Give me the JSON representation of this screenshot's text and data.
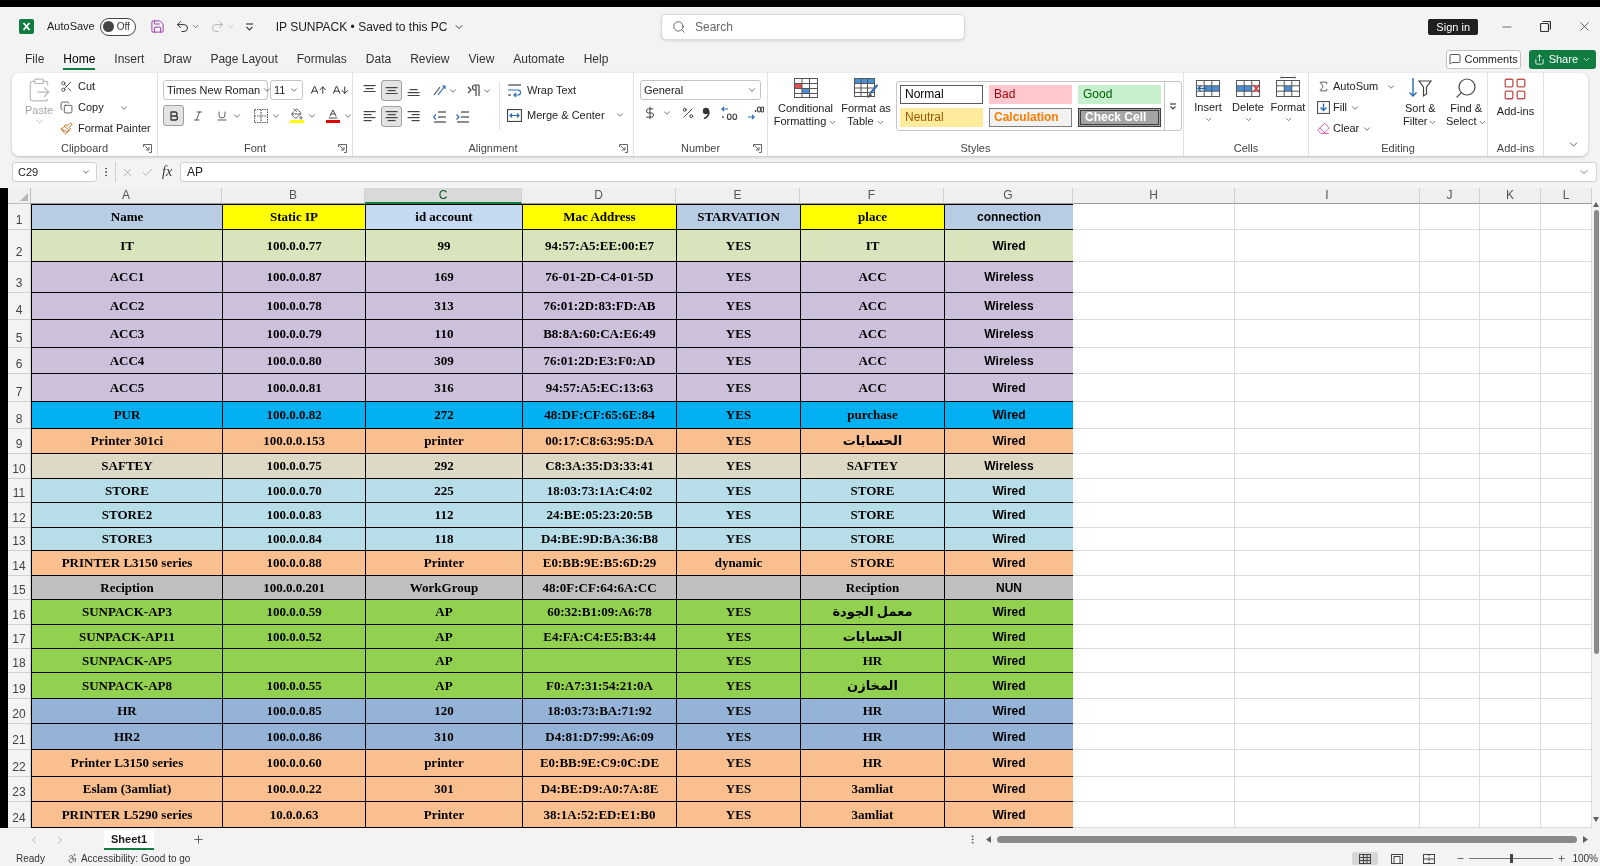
{
  "title_bar": {
    "autosave_label": "AutoSave",
    "autosave": {
      "label": "Off",
      "on": false
    },
    "quick_access": [
      {
        "kind": "save",
        "disabled": false
      },
      {
        "kind": "undo",
        "disabled": false
      },
      {
        "kind": "redo",
        "disabled": true
      }
    ],
    "document_title": "IP SUNPACK • Saved to this PC",
    "search": {
      "placeholder": "Search"
    },
    "sign_in": "Sign in"
  },
  "menu_tabs": [
    {
      "label": "File",
      "selected": false
    },
    {
      "label": "Home",
      "selected": true
    },
    {
      "label": "Insert",
      "selected": false
    },
    {
      "label": "Draw",
      "selected": false
    },
    {
      "label": "Page Layout",
      "selected": false
    },
    {
      "label": "Formulas",
      "selected": false
    },
    {
      "label": "Data",
      "selected": false
    },
    {
      "label": "Review",
      "selected": false
    },
    {
      "label": "View",
      "selected": false
    },
    {
      "label": "Automate",
      "selected": false
    },
    {
      "label": "Help",
      "selected": false
    }
  ],
  "header_actions": {
    "comments": "Comments",
    "share": "Share"
  },
  "ribbon": {
    "clipboard": {
      "title": "Clipboard",
      "paste": {
        "label": "Paste",
        "disabled": true
      },
      "cut": "Cut",
      "copy": "Copy",
      "format_painter": "Format Painter"
    },
    "font": {
      "title": "Font",
      "name": "Times New Roman",
      "size": "11",
      "formats": [
        {
          "kind": "bold",
          "active": true
        },
        {
          "kind": "italic",
          "active": false
        },
        {
          "kind": "underline",
          "active": false
        }
      ]
    },
    "alignment": {
      "title": "Alignment",
      "vertical": [
        {
          "kind": "top",
          "active": false
        },
        {
          "kind": "middle",
          "active": true
        },
        {
          "kind": "bottom",
          "active": false
        }
      ],
      "horizontal": [
        {
          "kind": "left",
          "active": false
        },
        {
          "kind": "center",
          "active": true
        },
        {
          "kind": "right",
          "active": false
        }
      ],
      "wrap_text": "Wrap Text",
      "merge_center": "Merge & Center"
    },
    "number": {
      "title": "Number",
      "format": "General"
    },
    "styles": {
      "title": "Styles",
      "conditional_formatting": "Conditional Formatting",
      "format_as_table": "Format as Table",
      "cell_styles": [
        {
          "label": "Normal",
          "kind": "normal"
        },
        {
          "label": "Bad",
          "kind": "bad"
        },
        {
          "label": "Good",
          "kind": "good"
        },
        {
          "label": "Neutral",
          "kind": "neutral"
        },
        {
          "label": "Calculation",
          "kind": "calculation"
        },
        {
          "label": "Check Cell",
          "kind": "check"
        }
      ]
    },
    "cells": {
      "title": "Cells",
      "buttons": [
        {
          "kind": "insert",
          "label": "Insert"
        },
        {
          "kind": "delete",
          "label": "Delete"
        },
        {
          "kind": "format",
          "label": "Format"
        }
      ]
    },
    "editing": {
      "title": "Editing",
      "autosum": "AutoSum",
      "fill": "Fill",
      "clear": "Clear",
      "sort_filter": "Sort & Filter",
      "find_select": "Find & Select"
    },
    "add_ins": {
      "title": "Add-ins",
      "button": "Add-ins"
    }
  },
  "formula_bar": {
    "name_box": "C29",
    "function_button": "fx",
    "formula": "AP"
  },
  "sheet": {
    "columns": [
      {
        "label": "A",
        "selected": false
      },
      {
        "label": "B",
        "selected": false
      },
      {
        "label": "C",
        "selected": true
      },
      {
        "label": "D",
        "selected": false
      },
      {
        "label": "E",
        "selected": false
      },
      {
        "label": "F",
        "selected": false
      },
      {
        "label": "G",
        "selected": false
      },
      {
        "label": "H",
        "selected": false
      },
      {
        "label": "I",
        "selected": false
      },
      {
        "label": "J",
        "selected": false
      },
      {
        "label": "K",
        "selected": false
      },
      {
        "label": "L",
        "selected": false
      }
    ],
    "header_row": {
      "number": "1",
      "cells": [
        {
          "text": "Name",
          "color": "#b8cce4"
        },
        {
          "text": "Static IP",
          "color": "#ffff00"
        },
        {
          "text": "id account",
          "color": "#c5d9f1"
        },
        {
          "text": "Mac Address",
          "color": "#ffff00"
        },
        {
          "text": "STARVATION",
          "color": "#b8cce4"
        },
        {
          "text": "place",
          "color": "#ffff00"
        },
        {
          "text": "connection",
          "color": "#b8cce4"
        }
      ]
    },
    "rows": [
      {
        "number": "2",
        "color": "#d8e4bc",
        "cells": [
          "IT",
          "100.0.0.77",
          "99",
          "94:57:A5:EE:00:E7",
          "YES",
          "IT",
          "Wired"
        ]
      },
      {
        "number": "3",
        "color": "#ccc0da",
        "cells": [
          "ACC1",
          "100.0.0.87",
          "169",
          "76-01-2D-C4-01-5D",
          "YES",
          "ACC",
          "Wireless"
        ]
      },
      {
        "number": "4",
        "color": "#ccc0da",
        "cells": [
          "ACC2",
          "100.0.0.78",
          "313",
          "76:01:2D:83:FD:AB",
          "YES",
          "ACC",
          "Wireless"
        ]
      },
      {
        "number": "5",
        "color": "#ccc0da",
        "cells": [
          "ACC3",
          "100.0.0.79",
          "110",
          "B8:8A:60:CA:E6:49",
          "YES",
          "ACC",
          "Wireless"
        ]
      },
      {
        "number": "6",
        "color": "#ccc0da",
        "cells": [
          "ACC4",
          "100.0.0.80",
          "309",
          "76:01:2D:E3:F0:AD",
          "YES",
          "ACC",
          "Wireless"
        ]
      },
      {
        "number": "7",
        "color": "#ccc0da",
        "cells": [
          "ACC5",
          "100.0.0.81",
          "316",
          "94:57:A5:EC:13:63",
          "YES",
          "ACC",
          "Wired"
        ]
      },
      {
        "number": "8",
        "color": "#00b0f0",
        "cells": [
          "PUR",
          "100.0.0.82",
          "272",
          "48:DF:CF:65:6E:84",
          "YES",
          "purchase",
          "Wired"
        ]
      },
      {
        "number": "9",
        "color": "#fabf8f",
        "cells": [
          "Printer 301ci",
          "100.0.0.153",
          "printer",
          "00:17:C8:63:95:DA",
          "YES",
          "الحسابات",
          "Wired"
        ]
      },
      {
        "number": "10",
        "color": "#ddd9c4",
        "cells": [
          "SAFTEY",
          "100.0.0.75",
          "292",
          "C8:3A:35:D3:33:41",
          "YES",
          "SAFTEY",
          "Wireless"
        ]
      },
      {
        "number": "11",
        "color": "#b7dee8",
        "cells": [
          "STORE",
          "100.0.0.70",
          "225",
          "18:03:73:1A:C4:02",
          "YES",
          "STORE",
          "Wired"
        ]
      },
      {
        "number": "12",
        "color": "#b7dee8",
        "cells": [
          "STORE2",
          "100.0.0.83",
          "112",
          "24:BE:05:23:20:5B",
          "YES",
          "STORE",
          "Wired"
        ]
      },
      {
        "number": "13",
        "color": "#b7dee8",
        "cells": [
          "STORE3",
          "100.0.0.84",
          "118",
          "D4:BE:9D:BA:36:B8",
          "YES",
          "STORE",
          "Wired"
        ]
      },
      {
        "number": "14",
        "color": "#fabf8f",
        "cells": [
          "PRINTER L3150 series",
          "100.0.0.88",
          "Printer",
          "E0:BB:9E:B5:6D:29",
          "dynamic",
          "STORE",
          "Wired"
        ]
      },
      {
        "number": "15",
        "color": "#bfbfbf",
        "cells": [
          "Reciption",
          "100.0.0.201",
          "WorkGroup",
          "48:0F:CF:64:6A:CC",
          null,
          "Reciption",
          "NUN"
        ]
      },
      {
        "number": "16",
        "color": "#92d050",
        "cells": [
          "SUNPACK-AP3",
          "100.0.0.59",
          "AP",
          "60:32:B1:09:A6:78",
          "YES",
          "معمل الجودة",
          "Wired"
        ]
      },
      {
        "number": "17",
        "color": "#92d050",
        "cells": [
          "SUNPACK-AP11",
          "100.0.0.52",
          "AP",
          "E4:FA:C4:E5:B3:44",
          "YES",
          "الحسابات",
          "Wired"
        ]
      },
      {
        "number": "18",
        "color": "#92d050",
        "cells": [
          "SUNPACK-AP5",
          null,
          "AP",
          null,
          "YES",
          "HR",
          "Wired"
        ]
      },
      {
        "number": "19",
        "color": "#92d050",
        "cells": [
          "SUNPACK-AP8",
          "100.0.0.55",
          "AP",
          "F0:A7:31:54:21:0A",
          "YES",
          "المخازن",
          "Wired"
        ]
      },
      {
        "number": "20",
        "color": "#95b3d7",
        "cells": [
          "HR",
          "100.0.0.85",
          "120",
          "18:03:73:BA:71:92",
          "YES",
          "HR",
          "Wired"
        ]
      },
      {
        "number": "21",
        "color": "#95b3d7",
        "cells": [
          "HR2",
          "100.0.0.86",
          "310",
          "D4:81:D7:99:A6:09",
          "YES",
          "HR",
          "Wired"
        ]
      },
      {
        "number": "22",
        "color": "#fabf8f",
        "cells": [
          "Printer L3150 series",
          "100.0.0.60",
          "printer",
          "E0:BB:9E:C9:0C:DE",
          "YES",
          "HR",
          "Wired"
        ]
      },
      {
        "number": "23",
        "color": "#fabf8f",
        "cells": [
          "Eslam (3amliat)",
          "100.0.0.22",
          "301",
          "D4:BE:D9:A0:7A:8E",
          "YES",
          "3amliat",
          "Wired"
        ]
      },
      {
        "number": "24",
        "color": "#fabf8f",
        "cells": [
          "PRINTER L5290 series",
          "10.0.0.63",
          "Printer",
          "38:1A:52:ED:E1:B0",
          "YES",
          "3amliat",
          "Wired"
        ]
      }
    ]
  },
  "sheet_tabs": [
    {
      "label": "Sheet1",
      "selected": true
    }
  ],
  "status_bar": {
    "status": "Ready",
    "accessibility": "Accessibility: Good to go",
    "views": [
      {
        "kind": "normal",
        "selected": true
      },
      {
        "kind": "page_layout",
        "selected": false
      },
      {
        "kind": "page_break",
        "selected": false
      }
    ],
    "zoom": {
      "level": 0.5,
      "reading": "100%"
    }
  }
}
